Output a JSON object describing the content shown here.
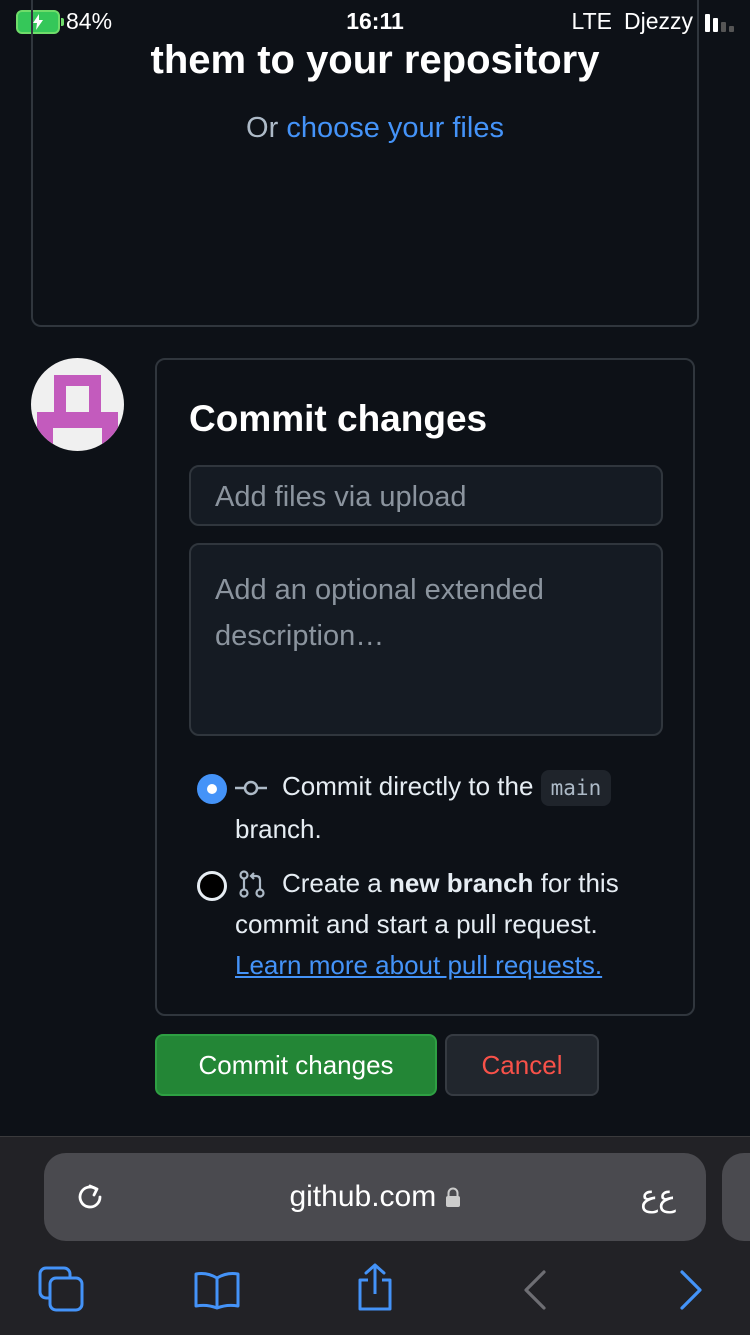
{
  "status_bar": {
    "battery": "84%",
    "time": "16:11",
    "network": "LTE",
    "carrier": "Djezzy"
  },
  "upload": {
    "title": "them to your repository",
    "or_text": "Or",
    "choose_link": "choose your files"
  },
  "commit": {
    "title": "Commit changes",
    "summary_placeholder": "Add files via upload",
    "description_placeholder": "Add an optional extended description…",
    "option_direct": {
      "text_before": "Commit directly to the",
      "branch": "main",
      "text_after": "branch.",
      "selected": true
    },
    "option_new": {
      "text_before": "Create a",
      "bold": "new branch",
      "text_after": "for this commit and start a pull request.",
      "link": "Learn more about pull requests.",
      "selected": false
    },
    "commit_button": "Commit changes",
    "cancel_button": "Cancel"
  },
  "browser": {
    "url": "github.com",
    "reader_label": "ﻉﻉ"
  },
  "colors": {
    "accent": "#4493f8",
    "primary_button": "#238636",
    "danger": "#f85149",
    "background": "#0d1117"
  },
  "icons": [
    "battery-charging-icon",
    "signal-icon",
    "commit-icon",
    "git-pull-request-icon",
    "lock-icon",
    "reload-icon",
    "tabs-icon",
    "bookmarks-icon",
    "share-icon",
    "back-icon",
    "forward-icon"
  ]
}
